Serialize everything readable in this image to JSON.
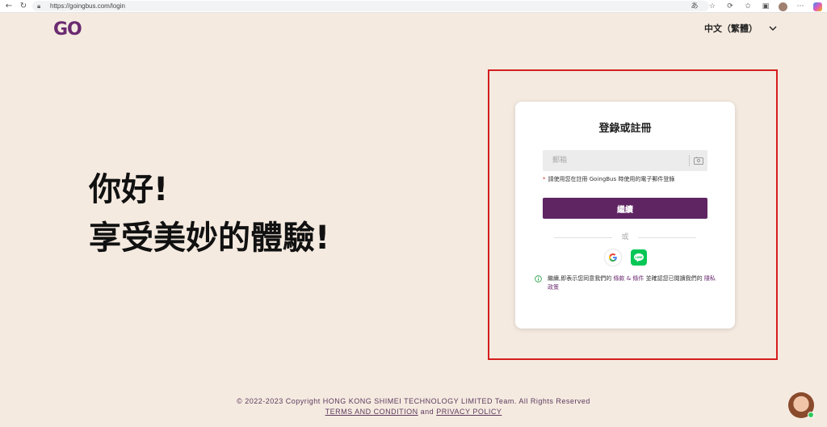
{
  "browser": {
    "url": "https://goingbus.com/login"
  },
  "header": {
    "logo": "GO",
    "language": "中文（繁體）"
  },
  "hero": {
    "line1": "你好!",
    "line2": "享受美妙的體驗!"
  },
  "login": {
    "title": "登錄或註冊",
    "email_placeholder": "郵箱",
    "hint_required": "*",
    "hint": "請使用您在註冊 GoingBus 時使用的電子郵件登錄",
    "continue_label": "繼續",
    "or_label": "或",
    "consent_prefix": "繼續,即表示您同意我們的",
    "terms_label": "條款 & 條件",
    "consent_middle": "並確認您已閱讀我們的",
    "privacy_label": "隱私政策"
  },
  "footer": {
    "copyright": "© 2022-2023 Copyright HONG KONG SHIMEI TECHNOLOGY LIMITED Team. All Rights Reserved",
    "terms_link": "TERMS AND CONDITION",
    "and": "and",
    "privacy_link": "PRIVACY POLICY"
  },
  "colors": {
    "brand_purple": "#5f2563",
    "background": "#f5eae0",
    "highlight_frame": "#d41e1e",
    "line_green": "#06c755"
  },
  "icons": {
    "email_field": "id-card-icon",
    "consent": "info-icon",
    "language": "chevron-down-icon"
  }
}
